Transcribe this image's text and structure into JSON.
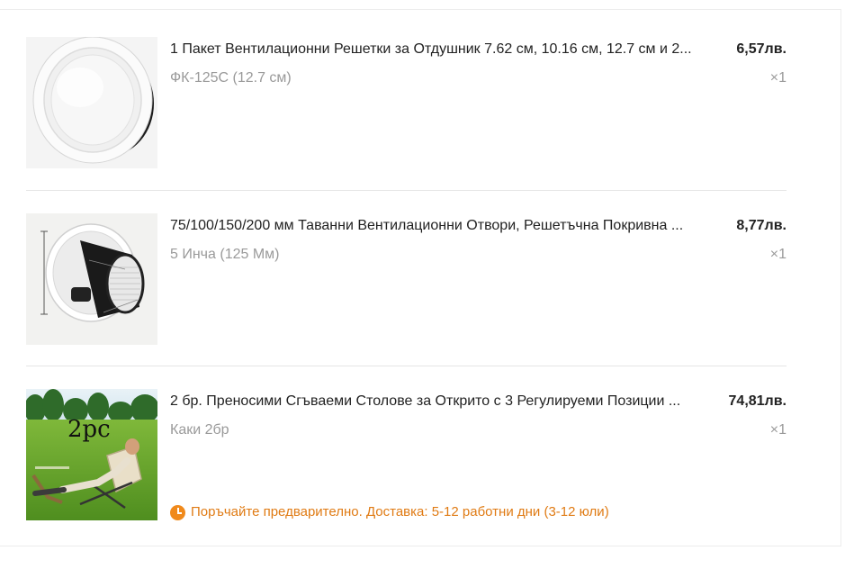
{
  "cart": {
    "items": [
      {
        "title": "1 Пакет Вентилационни Решетки за Отдушник 7.62 см, 10.16 см, 12.7 см и 2...",
        "price": "6,57лв.",
        "variant": "ФК-125С (12.7 см)",
        "quantity": "×1",
        "image": "round-white-vent-grille"
      },
      {
        "title": "75/100/150/200 мм Таванни Вентилационни Отвори, Решетъчна Покривна ...",
        "price": "8,77лв.",
        "variant": "5 Инча (125 Мм)",
        "quantity": "×1",
        "image": "ceiling-vent-black-duct"
      },
      {
        "title": "2 бр. Преносими Сгъваеми Столове за Открито с 3 Регулируеми Позиции ...",
        "price": "74,81лв.",
        "variant": "Каки 2бр",
        "quantity": "×1",
        "image": "folding-chairs-on-grass",
        "image_text": "2pc",
        "notice": "Поръчайте предварително. Доставка: 5-12 работни дни (3-12 юли)",
        "notice_icon": "clock-icon"
      }
    ]
  },
  "colors": {
    "notice": "#e07b14",
    "muted": "#9a9a9a",
    "text": "#222222",
    "divider": "#e6e6e6"
  }
}
